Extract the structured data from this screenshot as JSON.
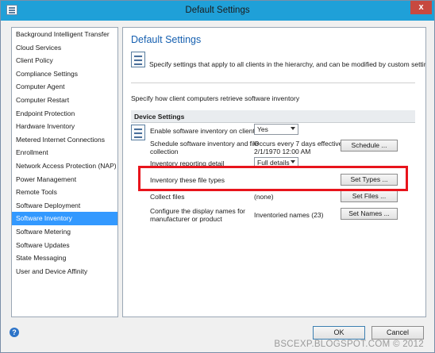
{
  "window": {
    "title": "Default Settings",
    "close_label": "x"
  },
  "sidebar": {
    "items": [
      "Background Intelligent Transfer",
      "Cloud Services",
      "Client Policy",
      "Compliance Settings",
      "Computer Agent",
      "Computer Restart",
      "Endpoint Protection",
      "Hardware Inventory",
      "Metered Internet Connections",
      "Enrollment",
      "Network Access Protection (NAP)",
      "Power Management",
      "Remote Tools",
      "Software Deployment",
      "Software Inventory",
      "Software Metering",
      "Software Updates",
      "State Messaging",
      "User and Device Affinity"
    ],
    "selected": "Software Inventory"
  },
  "content": {
    "title": "Default Settings",
    "description": "Specify settings that apply to all clients in the hierarchy, and can be modified by custom settings.",
    "sub_description": "Specify how client computers retrieve software inventory",
    "section_title": "Device Settings",
    "settings": {
      "enable": {
        "label": "Enable software inventory on clients",
        "value": "Yes"
      },
      "schedule": {
        "label_line1": "Schedule software inventory and file",
        "label_line2": "collection",
        "value_line1": "Occurs every 7 days effective",
        "value_line2": "2/1/1970 12:00 AM",
        "button": "Schedule ..."
      },
      "detail": {
        "label": "Inventory reporting detail",
        "value": "Full details"
      },
      "file_types": {
        "label": "Inventory these file types",
        "button": "Set Types ..."
      },
      "collect": {
        "label": "Collect files",
        "value": "(none)",
        "button": "Set Files ..."
      },
      "names": {
        "label_line1": "Configure the display names for",
        "label_line2": "manufacturer or product",
        "value": "Inventoried names (23)",
        "button": "Set Names ..."
      }
    }
  },
  "footer": {
    "help_icon": "?",
    "ok": "OK",
    "cancel": "Cancel"
  },
  "watermark": "BSCEXP.BLOGSPOT.COM © 2012",
  "colors": {
    "titlebar": "#1fa0d8",
    "selection": "#3399ff",
    "highlight": "#e8141c",
    "title_text": "#1660b0"
  }
}
